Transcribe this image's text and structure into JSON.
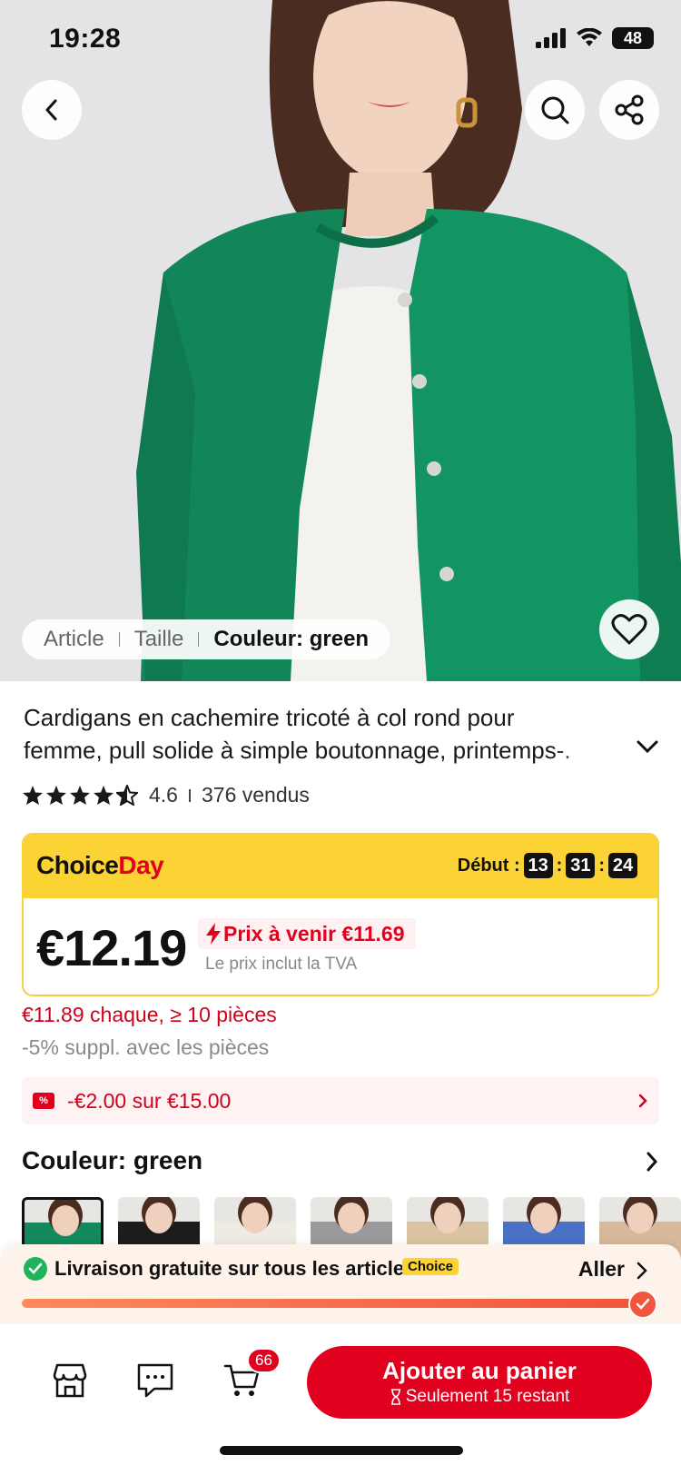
{
  "status": {
    "time": "19:28",
    "battery": "48"
  },
  "hero": {
    "sku_tabs": [
      "Article",
      "Taille"
    ],
    "sku_active": "Couleur: green"
  },
  "product": {
    "title_line1": "Cardigans en cachemire tricoté à col rond pour",
    "title_line2": "femme, pull solide à simple boutonnage, printemps-.",
    "rating": "4.6",
    "rating_fraction": 0.92,
    "sold": "376 vendus"
  },
  "choice": {
    "logo_choice": "Choice",
    "logo_day": "Day",
    "timer_label": "Début :",
    "timer": [
      "13",
      "31",
      "24"
    ],
    "price": "€12.19",
    "upcoming": "Prix à venir €11.69",
    "tva": "Le prix inclut la TVA"
  },
  "bulk_price": "€11.89 chaque, ≥ 10 pièces",
  "extra_discount": "-5% suppl. avec les pièces",
  "coupon": {
    "tag": "%",
    "text": "-€2.00 sur €15.00"
  },
  "color": {
    "label": "Couleur: green"
  },
  "thumbnails": [
    {
      "name": "green",
      "color": "#148a5c"
    },
    {
      "name": "black",
      "color": "#1c1c1c"
    },
    {
      "name": "white",
      "color": "#efeae2"
    },
    {
      "name": "grey",
      "color": "#9a9a9c"
    },
    {
      "name": "camel",
      "color": "#d9c3a0"
    },
    {
      "name": "blue",
      "color": "#4a72c4"
    },
    {
      "name": "beige",
      "color": "#d8b89a"
    }
  ],
  "shipping": {
    "text": "Livraison gratuite sur tous les articles",
    "badge": "Choice",
    "go": "Aller",
    "progress": 1.0
  },
  "bottom": {
    "cart_count": "66",
    "add_label": "Ajouter au panier",
    "stock": "Seulement 15 restant"
  },
  "colors": {
    "accent": "#e1001e",
    "choice_yellow": "#fbd334",
    "success": "#1fb35b"
  }
}
